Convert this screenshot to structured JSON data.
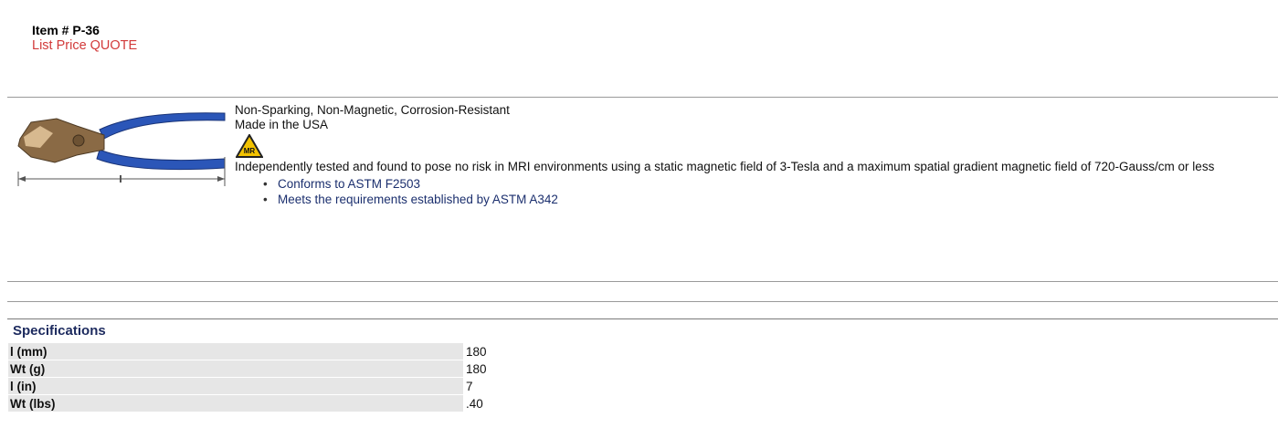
{
  "item": {
    "number": "Item # P-36",
    "list_price": "List Price QUOTE"
  },
  "product": {
    "image_icon": "pliers-icon",
    "features": [
      "Non-Sparking, Non-Magnetic, Corrosion-Resistant",
      "Made in the USA"
    ],
    "mr_badge": {
      "icon": "mr-safe-icon",
      "text": "MR"
    },
    "mri_statement": "Independently tested and found to pose no risk in MRI environments using a static magnetic field of 3-Tesla and a maximum spatial gradient magnetic field of 720-Gauss/cm or less",
    "standards": [
      "Conforms to ASTM F2503",
      "Meets the requirements established by ASTM A342"
    ]
  },
  "specifications": {
    "title": "Specifications",
    "rows": [
      {
        "label": "l (mm)",
        "value": "180"
      },
      {
        "label": "Wt (g)",
        "value": "180"
      },
      {
        "label": "l (in)",
        "value": "7"
      },
      {
        "label": "Wt (lbs)",
        "value": ".40"
      }
    ]
  },
  "colors": {
    "price": "#d23a3a",
    "link": "#1b2f6e",
    "handle": "#2b56b8",
    "badge": "#f2c200"
  }
}
